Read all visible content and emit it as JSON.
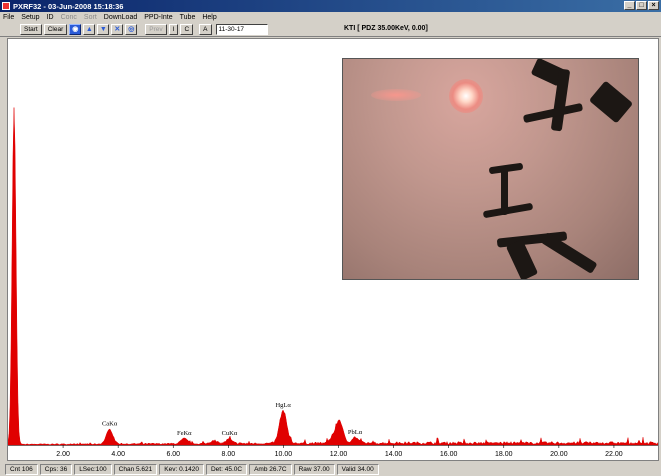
{
  "window": {
    "title": "PXRF32 - 03-Jun-2008 15:18:36",
    "buttons": [
      "_",
      "□",
      "×"
    ]
  },
  "menu": [
    {
      "label": "File",
      "disabled": false
    },
    {
      "label": "Setup",
      "disabled": false
    },
    {
      "label": "ID",
      "disabled": false
    },
    {
      "label": "Conc",
      "disabled": true
    },
    {
      "label": "Sort",
      "disabled": true
    },
    {
      "label": "DownLoad",
      "disabled": false
    },
    {
      "label": "PPD-Inte",
      "disabled": false
    },
    {
      "label": "Tube",
      "disabled": false
    },
    {
      "label": "Help",
      "disabled": false
    }
  ],
  "toolbar": {
    "start_label": "Start",
    "clear_label": "Clear",
    "icon_buttons": [
      "zoom-in-icon",
      "arrow-up-icon",
      "arrow-down-icon",
      "fit-icon",
      "reset-icon"
    ],
    "icon_glyphs": [
      "◉",
      "▲",
      "▼",
      "✕",
      "◎"
    ],
    "prev_label": "Prev",
    "i_label": "I",
    "c_label": "C",
    "a_label": "A",
    "time_value": "11-30-17"
  },
  "status_title": "KTI  [ PDZ 35.00KeV, 0.00]",
  "chart_data": {
    "type": "line",
    "xlabel": "",
    "ylabel": "",
    "xlim": [
      0,
      23.6
    ],
    "x_ticks": [
      2,
      4,
      6,
      8,
      10,
      12,
      14,
      16,
      18,
      20,
      22
    ],
    "x_tick_labels": [
      "2.00",
      "4.00",
      "6.00",
      "8.00",
      "10.00",
      "12.00",
      "14.00",
      "16.00",
      "18.00",
      "20.00",
      "22.00"
    ],
    "ylim": [
      0,
      100
    ],
    "series": [
      {
        "color": "#e00000",
        "peaks": [
          {
            "x": 0.22,
            "y": 92,
            "w": 0.07
          },
          {
            "x": 3.69,
            "y": 4.0,
            "w": 0.12
          },
          {
            "x": 6.4,
            "y": 1.4,
            "w": 0.12
          },
          {
            "x": 7.48,
            "y": 0.9,
            "w": 0.12
          },
          {
            "x": 8.04,
            "y": 1.3,
            "w": 0.12
          },
          {
            "x": 9.99,
            "y": 9.0,
            "w": 0.13
          },
          {
            "x": 11.82,
            "y": 1.8,
            "w": 0.12
          },
          {
            "x": 12.04,
            "y": 6.0,
            "w": 0.12
          },
          {
            "x": 12.6,
            "y": 1.6,
            "w": 0.12
          }
        ],
        "background_level": 0.55
      }
    ],
    "annotations": [
      {
        "label": "CaKα",
        "x": 3.69
      },
      {
        "label": "FeKα",
        "x": 6.4
      },
      {
        "label": "CuKα",
        "x": 8.04
      },
      {
        "label": "HgLα",
        "x": 9.99
      },
      {
        "label": "PbLα",
        "x": 12.6
      }
    ]
  },
  "statusbar": [
    "Cnt 106",
    "Cps: 36",
    "LSec:100",
    "Chan 5.621",
    "Kev: 0.1420",
    "Det: 45.0C",
    "Amb 26.7C",
    "Raw 37.00",
    "Valid 34.00"
  ]
}
